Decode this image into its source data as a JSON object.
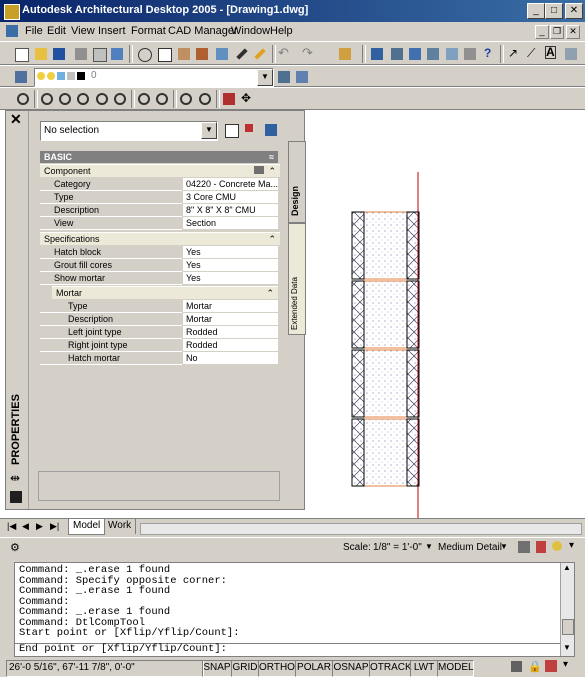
{
  "titlebar": {
    "title": "Autodesk Architectural Desktop 2005 - [Drawing1.dwg]"
  },
  "menu": [
    "File",
    "Edit",
    "View",
    "Insert",
    "Format",
    "CAD Manager",
    "Window",
    "Help"
  ],
  "layer_combo": {
    "value": "0"
  },
  "palette": {
    "selection": "No selection",
    "side_label": "PROPERTIES",
    "tabs": {
      "design": "Design",
      "extended": "Extended Data"
    },
    "basic": "BASIC",
    "component_header": "Component",
    "component": [
      {
        "k": "Category",
        "v": "04220 - Concrete Ma..."
      },
      {
        "k": "Type",
        "v": "3 Core CMU"
      },
      {
        "k": "Description",
        "v": "8\" X 8\" X 8\" CMU"
      },
      {
        "k": "View",
        "v": "Section"
      }
    ],
    "spec_header": "Specifications",
    "spec": [
      {
        "k": "Hatch block",
        "v": "Yes"
      },
      {
        "k": "Grout fill cores",
        "v": "Yes"
      },
      {
        "k": "Show mortar",
        "v": "Yes"
      }
    ],
    "mortar_header": "Mortar",
    "mortar": [
      {
        "k": "Type",
        "v": "Mortar"
      },
      {
        "k": "Description",
        "v": "Mortar"
      },
      {
        "k": "Left joint type",
        "v": "Rodded"
      },
      {
        "k": "Right joint type",
        "v": "Rodded"
      },
      {
        "k": "Hatch mortar",
        "v": "No"
      }
    ]
  },
  "tabs": {
    "model": "Model",
    "work": "Work"
  },
  "drawing_status": {
    "scale_label": "Scale:",
    "scale": "1/8\" = 1'-0\"",
    "detail": "Medium Detail"
  },
  "command_lines": [
    "Command: _.erase 1 found",
    "Command: Specify opposite corner:",
    "Command: _.erase 1 found",
    "Command:",
    "Command: _.erase 1 found",
    "Command: DtlCompTool",
    "Start point or [Xflip/Yflip/Count]:",
    "End point or [Xflip/Yflip/Count]:"
  ],
  "status": {
    "coords": "26'-0 5/16\", 67'-11 7/8\", 0'-0\"",
    "toggles": [
      "SNAP",
      "GRID",
      "ORTHO",
      "POLAR",
      "OSNAP",
      "OTRACK",
      "LWT",
      "MODEL"
    ]
  }
}
